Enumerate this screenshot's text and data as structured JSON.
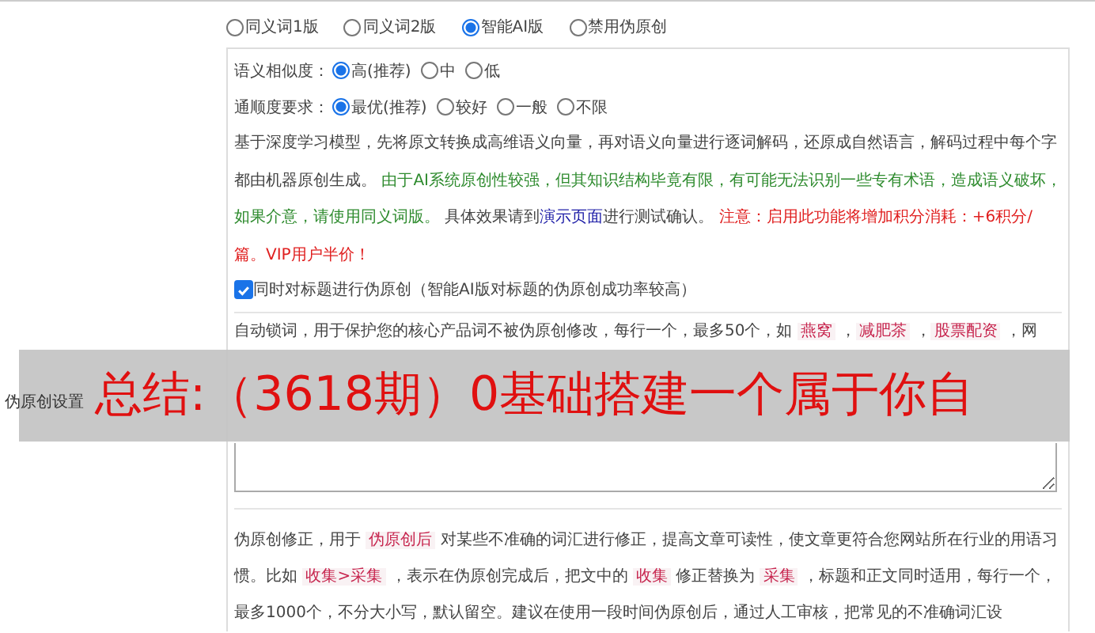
{
  "mode_options": [
    {
      "label": "同义词1版",
      "selected": false
    },
    {
      "label": "同义词2版",
      "selected": false
    },
    {
      "label": "智能AI版",
      "selected": true
    },
    {
      "label": "禁用伪原创",
      "selected": false
    }
  ],
  "similarity": {
    "label": "语义相似度：",
    "options": [
      {
        "label": "高(推荐)",
        "selected": true
      },
      {
        "label": "中",
        "selected": false
      },
      {
        "label": "低",
        "selected": false
      }
    ]
  },
  "fluency": {
    "label": "通顺度要求：",
    "options": [
      {
        "label": "最优(推荐)",
        "selected": true
      },
      {
        "label": "较好",
        "selected": false
      },
      {
        "label": "一般",
        "selected": false
      },
      {
        "label": "不限",
        "selected": false
      }
    ]
  },
  "description": [
    {
      "kind": "plain",
      "text": "基于深度学习模型，先将原文转换成高维语义向量，再对语义向量进行逐词解码，还原成自然语言，解码过程中每个字都由机器原创生成。 "
    },
    {
      "kind": "green",
      "text": "由于AI系统原创性较强，但其知识结构毕竟有限，有可能无法识别一些专有术语，造成语义破坏，如果介意，请使用同义词版。"
    },
    {
      "kind": "plain",
      "text": " 具体效果请到"
    },
    {
      "kind": "link",
      "text": "演示页面"
    },
    {
      "kind": "plain",
      "text": "进行测试确认。 "
    },
    {
      "kind": "red",
      "text": "注意：启用此功能将增加积分消耗：+6积分/篇。VIP用户半价！"
    }
  ],
  "title_checkbox": {
    "label": "同时对标题进行伪原创（智能AI版对标题的伪原创成功率较高）",
    "checked": true
  },
  "section_label": "伪原创设置",
  "lock_words": [
    {
      "kind": "plain",
      "text": "自动锁词，用于保护您的核心产品词不被伪原创修改，每行一个，最多50个，如 "
    },
    {
      "kind": "tag",
      "text": "燕窝"
    },
    {
      "kind": "plain",
      "text": " ，"
    },
    {
      "kind": "tag",
      "text": "减肥茶"
    },
    {
      "kind": "plain",
      "text": " ，"
    },
    {
      "kind": "tag",
      "text": "股票配资"
    },
    {
      "kind": "plain",
      "text": " ，网"
    }
  ],
  "correction": [
    {
      "kind": "plain",
      "text": "伪原创修正，用于 "
    },
    {
      "kind": "tag",
      "text": "伪原创后"
    },
    {
      "kind": "plain",
      "text": " 对某些不准确的词汇进行修正，提高文章可读性，使文章更符合您网站所在行业的用语习惯。比如 "
    },
    {
      "kind": "tag",
      "text": "收集>采集"
    },
    {
      "kind": "plain",
      "text": " ，表示在伪原创完成后，把文中的 "
    },
    {
      "kind": "tag",
      "text": "收集"
    },
    {
      "kind": "plain",
      "text": " 修正替换为 "
    },
    {
      "kind": "tag",
      "text": "采集"
    },
    {
      "kind": "plain",
      "text": " ，标题和正文同时适用，每行一个，最多1000个，不分大小写，默认留空。建议在使用一段时间伪原创后，通过人工审核，把常见的不准确词汇设"
    }
  ],
  "overlay_banner": {
    "text": "总结:（3618期）0基础搭建一个属于你自"
  }
}
